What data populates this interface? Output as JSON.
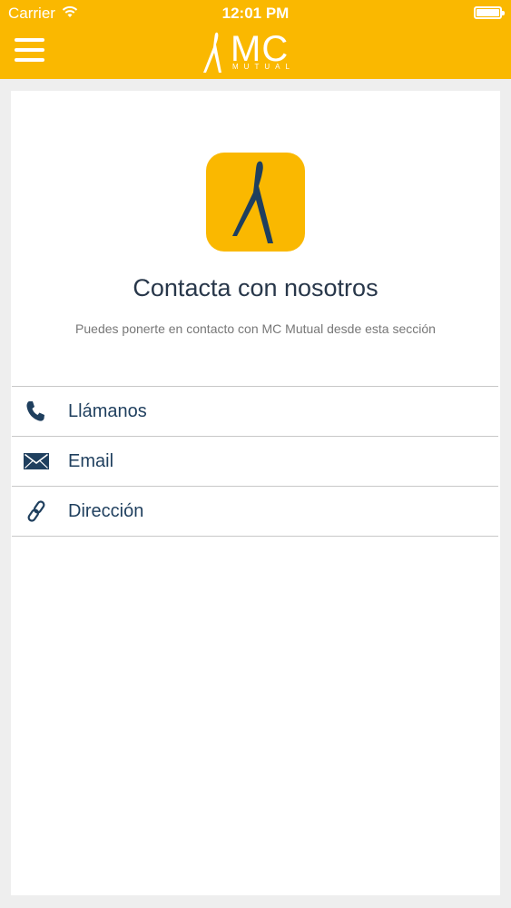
{
  "status_bar": {
    "carrier": "Carrier",
    "time": "12:01 PM"
  },
  "header": {
    "logo_text": "MC",
    "logo_sub": "MUTUAL",
    "menu_icon": "hamburger-menu-icon"
  },
  "main": {
    "title": "Contacta con nosotros",
    "subtitle": "Puedes ponerte en contacto con MC Mutual desde esta sección",
    "contact_items": [
      {
        "label": "Llámanos",
        "icon": "phone-icon"
      },
      {
        "label": "Email",
        "icon": "envelope-icon"
      },
      {
        "label": "Dirección",
        "icon": "link-icon"
      }
    ]
  },
  "colors": {
    "brand": "#fab800",
    "icon": "#1f3f5e",
    "title": "#28374a",
    "subtitle": "#777777"
  }
}
